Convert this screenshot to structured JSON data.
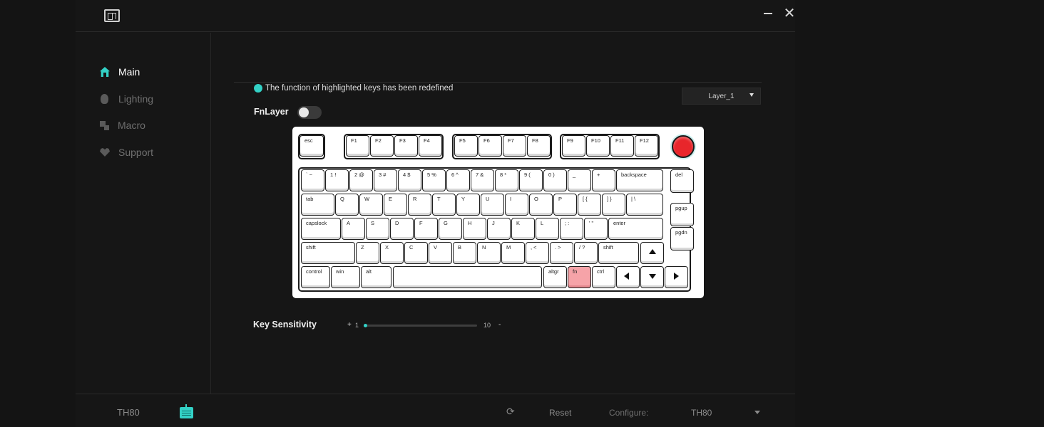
{
  "window": {
    "minimize_icon": "minimize-icon",
    "close_glyph": "✕"
  },
  "sidebar": {
    "items": [
      {
        "label": "Main",
        "icon": "home-icon",
        "active": true
      },
      {
        "label": "Lighting",
        "icon": "bulb-icon",
        "active": false
      },
      {
        "label": "Macro",
        "icon": "macro-icon",
        "active": false
      },
      {
        "label": "Support",
        "icon": "heart-icon",
        "active": false
      }
    ]
  },
  "main": {
    "notice": "The function of highlighted keys has been redefined",
    "layer_select": "Layer_1",
    "fnlayer_label": "FnLayer",
    "fnlayer_enabled": false
  },
  "keyboard": {
    "keys": [
      "esc",
      "F1",
      "F2",
      "F3",
      "F4",
      "F5",
      "F6",
      "F7",
      "F8",
      "F9",
      "F10",
      "F11",
      "F12",
      "` ~",
      "1 !",
      "2 @",
      "3 #",
      "4 $",
      "5 %",
      "6 ^",
      "7 &",
      "8 *",
      "9 (",
      "0 )",
      "_",
      "+",
      "backspace",
      "del",
      "tab",
      "Q",
      "W",
      "E",
      "R",
      "T",
      "Y",
      "U",
      "I",
      "O",
      "P",
      "[ {",
      "] }",
      "| \\",
      "pgup",
      "capslock",
      "A",
      "S",
      "D",
      "F",
      "G",
      "H",
      "J",
      "K",
      "L",
      "; :",
      "' \"",
      "enter",
      "pgdn",
      "shift",
      "Z",
      "X",
      "C",
      "V",
      "B",
      "N",
      "M",
      ", <",
      ". >",
      "/ ?",
      "shift",
      "control",
      "win",
      "alt",
      "",
      "altgr",
      "fn",
      "ctrl"
    ],
    "highlighted": [
      "fn"
    ],
    "knob_color": "#e8262b"
  },
  "sensitivity": {
    "label": "Key Sensitivity",
    "plus": "+",
    "min": "1",
    "max": "10",
    "minus": "-",
    "value": 1
  },
  "footer": {
    "device": "TH80",
    "device_icon": "keyboard-icon",
    "refresh_glyph": "⟳",
    "reset": "Reset",
    "configure_label": "Configure:",
    "configure_value": "TH80"
  },
  "colors": {
    "accent": "#33d1c6",
    "highlight_key": "#f6a3a8",
    "background": "#161616"
  }
}
